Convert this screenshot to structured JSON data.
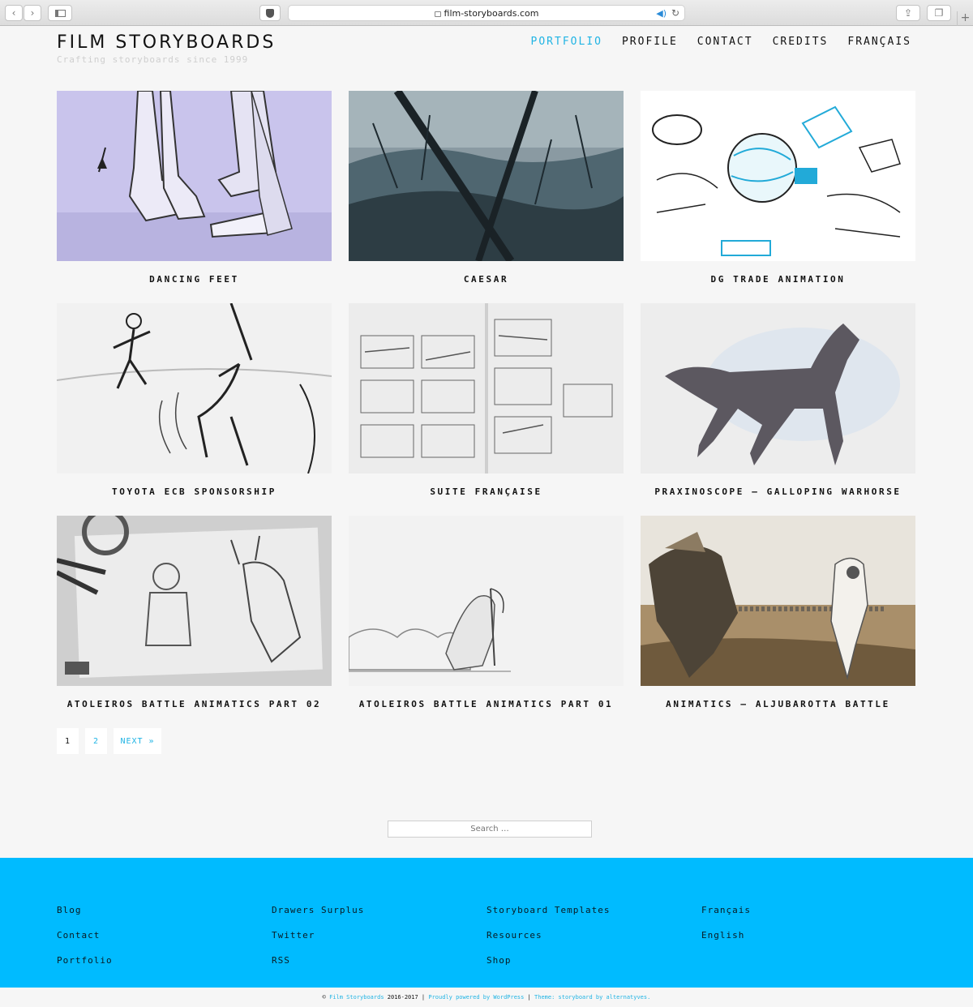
{
  "browser": {
    "url": "film-storyboards.com",
    "icons": [
      "back-icon",
      "forward-icon",
      "sidebar-icon",
      "shield-icon",
      "lock-icon",
      "audio-icon",
      "reload-icon",
      "share-icon",
      "tabs-icon",
      "new-tab-icon"
    ],
    "new_tab_glyph": "+"
  },
  "header": {
    "title": "FILM STORYBOARDS",
    "tagline": "Crafting storyboards since 1999",
    "nav": [
      {
        "label": "PORTFOLIO",
        "active": true
      },
      {
        "label": "PROFILE",
        "active": false
      },
      {
        "label": "CONTACT",
        "active": false
      },
      {
        "label": "CREDITS",
        "active": false
      },
      {
        "label": "FRANÇAIS",
        "active": false
      }
    ],
    "accent_color": "#21b4e4"
  },
  "portfolio": {
    "items": [
      {
        "title": "DANCING FEET"
      },
      {
        "title": "CAESAR"
      },
      {
        "title": "DG TRADE ANIMATION"
      },
      {
        "title": "TOYOTA ECB SPONSORSHIP"
      },
      {
        "title": "SUITE FRANÇAISE"
      },
      {
        "title": "PRAXINOSCOPE – GALLOPING WARHORSE"
      },
      {
        "title": "ATOLEIROS BATTLE ANIMATICS PART 02"
      },
      {
        "title": "ATOLEIROS BATTLE ANIMATICS PART 01"
      },
      {
        "title": "ANIMATICS – ALJUBAROTTA BATTLE"
      }
    ]
  },
  "pagination": {
    "pages": [
      "1",
      "2"
    ],
    "current": "1",
    "next_label": "NEXT »"
  },
  "search": {
    "placeholder": "Search …"
  },
  "footer": {
    "background": "#00bbff",
    "columns": [
      [
        "Blog",
        "Contact",
        "Portfolio"
      ],
      [
        "Drawers Surplus",
        "Twitter",
        "RSS"
      ],
      [
        "Storyboard Templates",
        "Resources",
        "Shop"
      ],
      [
        "Français",
        "English"
      ]
    ],
    "copyright": {
      "prefix": "©",
      "site": "Film Storyboards",
      "years": "2016-2017",
      "sep": "|",
      "powered": "Proudly powered by WordPress",
      "theme": "Theme: storyboard by alternatyves."
    }
  }
}
